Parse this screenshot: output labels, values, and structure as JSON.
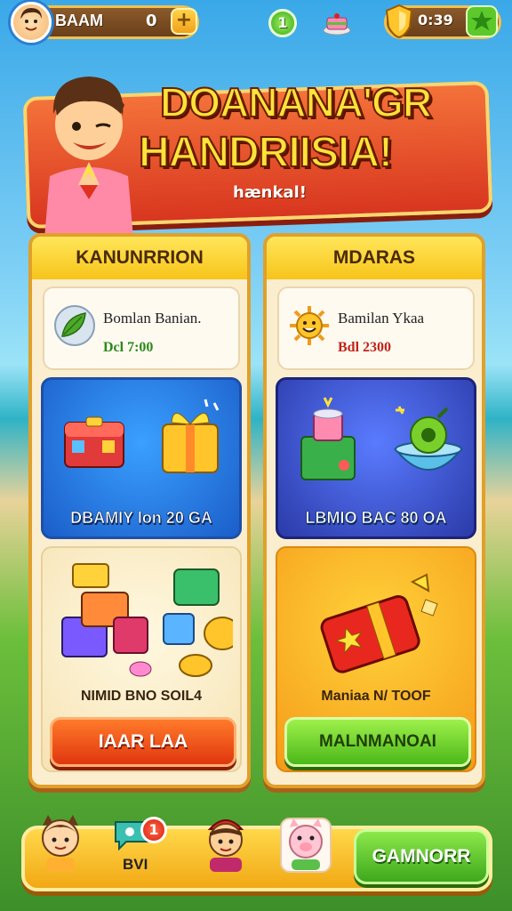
{
  "top_bar": {
    "player_name": "BAAM",
    "coins": "0",
    "plus_label": "+",
    "level": "1",
    "timer": "0:39"
  },
  "banner": {
    "title_line1": "DOANANA'GR",
    "title_line2": "HANDRIISIA!",
    "subtitle": "hænkal!"
  },
  "panels": [
    {
      "header": "KANUNRRION",
      "info_title": "Bomlan Banian.",
      "info_price": "Dcl 7:00",
      "info_price_color": "#2a8a1a",
      "offer_label": "DBAMIY lon 20 GA",
      "bundle_label": "NIMID BNO SOIL4",
      "button_label": "IAAR LAA"
    },
    {
      "header": "MDARAS",
      "info_title": "Bamilan Ykaa",
      "info_price": "Bdl 2300",
      "info_price_color": "#c0241a",
      "offer_label": "LBMIO BAC 80 OA",
      "bundle_label": "Maniaa N/ TOOF",
      "button_label": "MALNMANOAI"
    }
  ],
  "bottom_nav": {
    "notification_count": "1",
    "nav_label": "BVI",
    "play_label": "GAMNORR"
  },
  "colors": {
    "accent_yellow": "#f7c419",
    "accent_red": "#e0360f",
    "accent_green": "#4cb81a",
    "panel_border": "#e0a02a"
  }
}
